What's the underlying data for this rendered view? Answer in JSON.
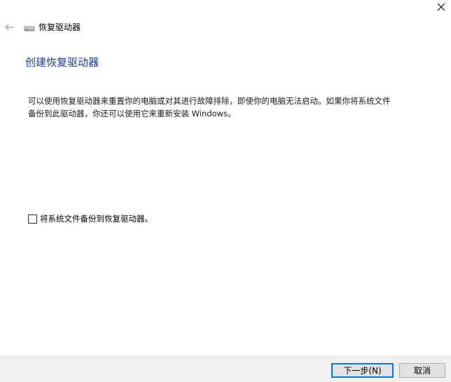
{
  "window": {
    "title": "恢复驱动器"
  },
  "page": {
    "heading": "创建恢复驱动器",
    "description": "可以使用恢复驱动器来重置你的电脑或对其进行故障排除，即使你的电脑无法启动。如果你将系统文件备份到此驱动器，你还可以使用它来重新安装 Windows。"
  },
  "options": {
    "backup_checkbox_label": "将系统文件备份到恢复驱动器。",
    "backup_checked": false
  },
  "buttons": {
    "next_label": "下一步(N)",
    "cancel_label": "取消"
  },
  "colors": {
    "heading": "#1e3c8c",
    "footer_bg": "#f0f0f0",
    "primary_border": "#0078d7"
  },
  "icons": {
    "close": "close-icon",
    "back": "back-arrow-icon",
    "drive": "drive-icon"
  }
}
